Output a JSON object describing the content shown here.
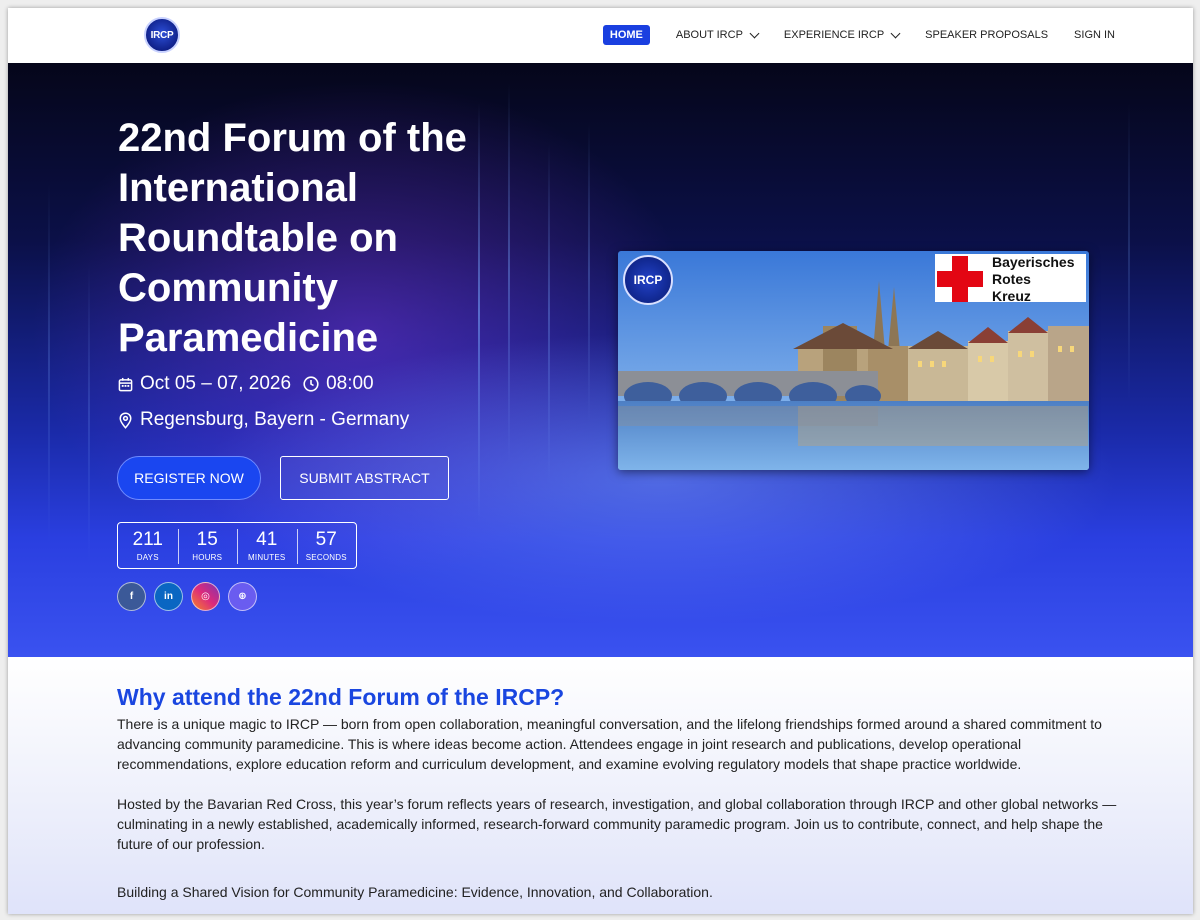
{
  "nav": {
    "logo_text": "IRCP",
    "items": [
      {
        "label": "HOME",
        "active": true,
        "dropdown": false
      },
      {
        "label": "ABOUT IRCP",
        "active": false,
        "dropdown": true
      },
      {
        "label": "EXPERIENCE IRCP",
        "active": false,
        "dropdown": true
      },
      {
        "label": "SPEAKER PROPOSALS",
        "active": false,
        "dropdown": false
      },
      {
        "label": "SIGN IN",
        "active": false,
        "dropdown": false
      }
    ]
  },
  "hero": {
    "title": "22nd Forum of the International Roundtable on Community Paramedicine",
    "date": "Oct 05 – 07, 2026",
    "time": "08:00",
    "location": "Regensburg, Bayern - Germany",
    "register_label": "REGISTER NOW",
    "submit_label": "SUBMIT ABSTRACT",
    "countdown": [
      {
        "value": "211",
        "label": "DAYS"
      },
      {
        "value": "15",
        "label": "HOURS"
      },
      {
        "value": "41",
        "label": "MINUTES"
      },
      {
        "value": "57",
        "label": "SECONDS"
      }
    ],
    "social": [
      {
        "icon": "facebook-icon",
        "glyph": "f",
        "color": "#3b5998"
      },
      {
        "icon": "linkedin-icon",
        "glyph": "in",
        "color": "#0a66c2"
      },
      {
        "icon": "instagram-icon",
        "glyph": "◎",
        "color": "#e1306c"
      },
      {
        "icon": "website-icon",
        "glyph": "⊕",
        "color": "#6a5cf0"
      }
    ],
    "image": {
      "logo_text": "IRCP",
      "brk_line1": "Bayerisches",
      "brk_line2": "Rotes",
      "brk_line3": "Kreuz"
    }
  },
  "about": {
    "heading": "Why attend the 22nd Forum of the IRCP?",
    "paragraph1": "There is a unique magic to IRCP — born from open collaboration, meaningful conversation, and the lifelong friendships formed around a shared commitment to advancing community paramedicine. This is where ideas become action. Attendees engage in joint research and publications, develop operational recommendations, explore education reform and curriculum development, and examine evolving regulatory models that shape practice worldwide.",
    "paragraph2": "Hosted by the Bavarian Red Cross, this year’s forum reflects years of research, investigation, and global collaboration through IRCP and other global networks — culminating in a newly established, academically informed, research-forward community paramedic program. Join us to contribute, connect, and help shape the future of our profession.",
    "tagline": "Building a Shared Vision for Community Paramedicine: Evidence, Innovation, and Collaboration."
  }
}
